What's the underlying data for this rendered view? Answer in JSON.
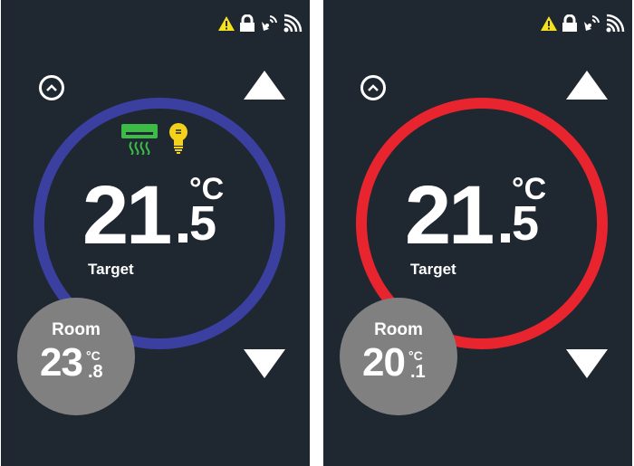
{
  "colors": {
    "background": "#1f2731",
    "cooling_ring": "#3a3fa0",
    "heating_ring": "#e8242f",
    "room_bubble": "#808080",
    "warning": "#f6e21b",
    "ac_icon": "#3dbb47",
    "bulb_icon": "#f4d21c"
  },
  "panels": [
    {
      "ring_color": "#3a3fa0",
      "target": {
        "int": "21",
        "frac": "5",
        "unit": "°C",
        "label": "Target"
      },
      "room": {
        "label": "Room",
        "int": "23",
        "frac": ".8",
        "unit": "°C"
      },
      "active_icons": [
        "air-conditioner-icon",
        "light-bulb-icon"
      ],
      "status_icons": [
        "warning-icon",
        "lock-icon",
        "satellite-icon",
        "wifi-icon"
      ]
    },
    {
      "ring_color": "#e8242f",
      "target": {
        "int": "21",
        "frac": "5",
        "unit": "°C",
        "label": "Target"
      },
      "room": {
        "label": "Room",
        "int": "20",
        "frac": ".1",
        "unit": "°C"
      },
      "active_icons": [],
      "status_icons": [
        "warning-icon",
        "lock-icon",
        "satellite-icon",
        "wifi-icon"
      ]
    }
  ]
}
